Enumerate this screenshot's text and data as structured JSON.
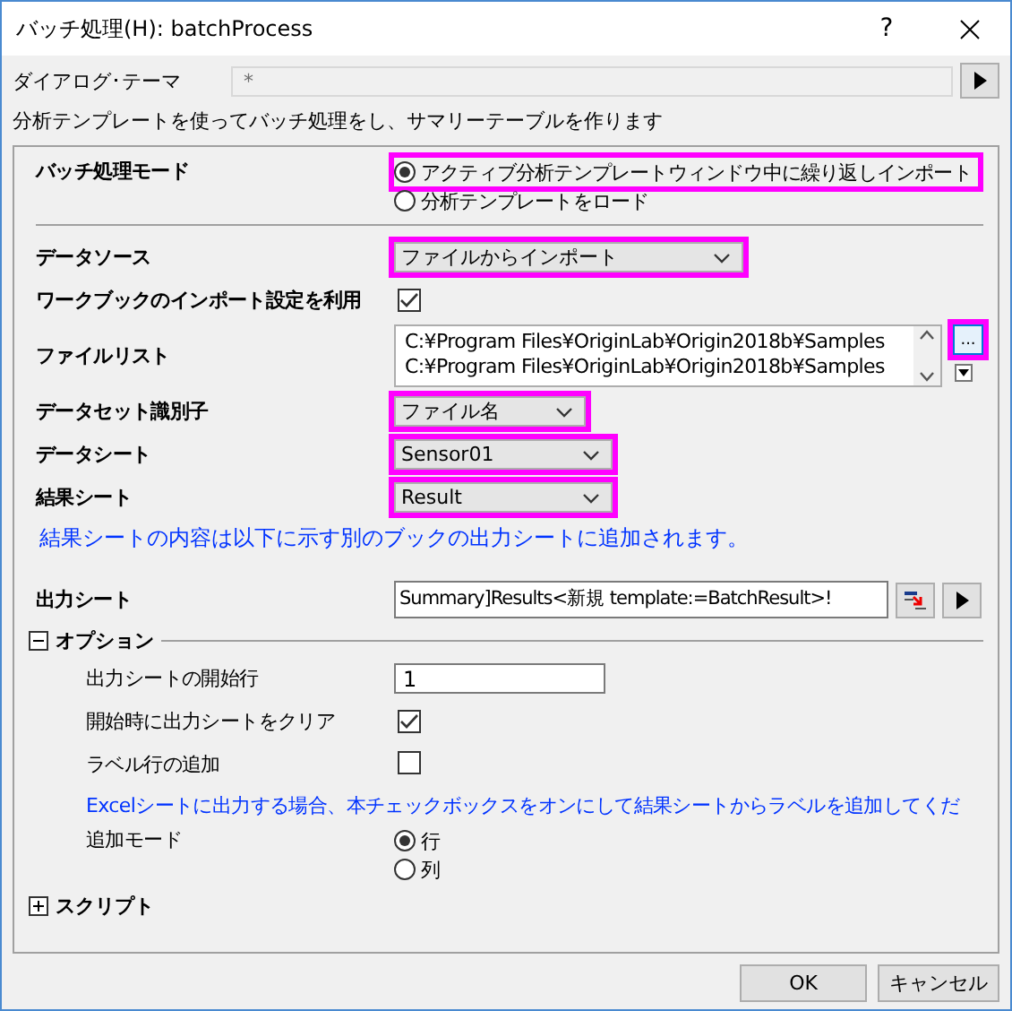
{
  "window": {
    "title": "バッチ処理(H): batchProcess",
    "help": "?"
  },
  "theme": {
    "label": "ダイアログ･テーマ",
    "value": "*",
    "disabled": true
  },
  "description": "分析テンプレートを使ってバッチ処理をし、サマリーテーブルを作ります",
  "rows": [
    {
      "kind": "radio",
      "label": "バッチ処理モード",
      "options": [
        {
          "label": "アクティブ分析テンプレートウィンドウ中に繰り返しインポート",
          "selected": true,
          "highlighted": true
        },
        {
          "label": "分析テンプレートをロード",
          "selected": false,
          "highlighted": false
        }
      ]
    },
    {
      "kind": "divider"
    },
    {
      "kind": "dropdown",
      "label": "データソース",
      "value": "ファイルからインポート",
      "highlighted": true
    },
    {
      "kind": "checkbox",
      "label": "ワークブックのインポート設定を利用",
      "checked": true
    },
    {
      "kind": "filelist",
      "label": "ファイルリスト",
      "items": [
        "C:¥Program Files¥OriginLab¥Origin2018b¥Samples",
        "C:¥Program Files¥OriginLab¥Origin2018b¥Samples"
      ],
      "browse": "...",
      "highlighted": true
    },
    {
      "kind": "dropdown",
      "label": "データセット識別子",
      "value": "ファイル名",
      "highlighted": true
    },
    {
      "kind": "dropdown",
      "label": "データシート",
      "value": "Sensor01",
      "highlighted": true
    },
    {
      "kind": "dropdown",
      "label": "結果シート",
      "value": "Result",
      "highlighted": true
    },
    {
      "kind": "note",
      "text": "結果シートの内容は以下に示す別のブックの出力シートに追加されます。"
    },
    {
      "kind": "output",
      "label": "出力シート",
      "value": "Summary]Results<新規 template:=BatchResult>!"
    }
  ],
  "groups": [
    {
      "label": "オプション",
      "expanded": true,
      "rows": [
        {
          "kind": "text",
          "label": "出力シートの開始行",
          "value": "1"
        },
        {
          "kind": "checkbox",
          "label": "開始時に出力シートをクリア",
          "checked": true
        },
        {
          "kind": "checkbox",
          "label": "ラベル行の追加",
          "checked": false
        },
        {
          "kind": "note",
          "text": "Excelシートに出力する場合、本チェックボックスをオンにして結果シートからラベルを追加してくだ"
        },
        {
          "kind": "radio",
          "label": "追加モード",
          "options": [
            {
              "label": "行",
              "selected": true
            },
            {
              "label": "列",
              "selected": false
            }
          ]
        }
      ]
    },
    {
      "label": "スクリプト",
      "expanded": false
    }
  ],
  "buttons": [
    "OK",
    "キャンセル"
  ]
}
